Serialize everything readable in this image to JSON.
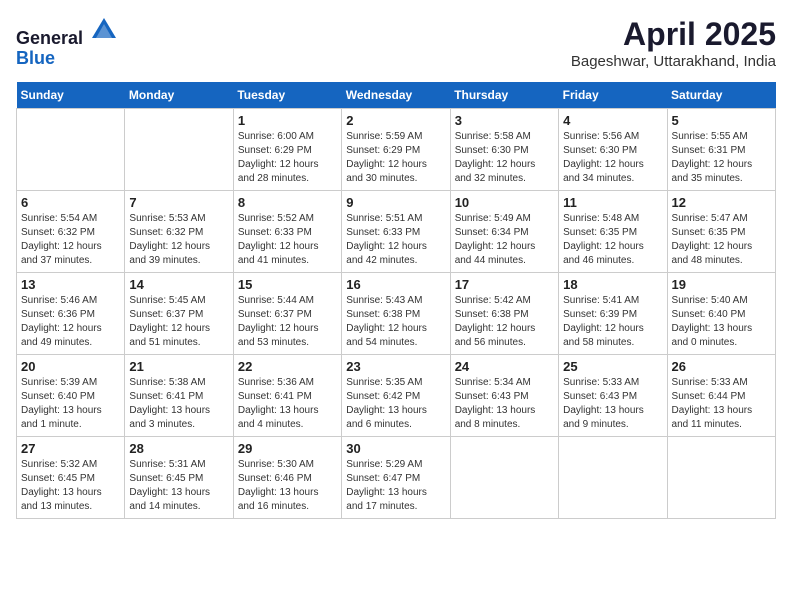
{
  "header": {
    "logo_line1": "General",
    "logo_line2": "Blue",
    "month": "April 2025",
    "location": "Bageshwar, Uttarakhand, India"
  },
  "days_of_week": [
    "Sunday",
    "Monday",
    "Tuesday",
    "Wednesday",
    "Thursday",
    "Friday",
    "Saturday"
  ],
  "weeks": [
    [
      {
        "day": "",
        "info": ""
      },
      {
        "day": "",
        "info": ""
      },
      {
        "day": "1",
        "info": "Sunrise: 6:00 AM\nSunset: 6:29 PM\nDaylight: 12 hours\nand 28 minutes."
      },
      {
        "day": "2",
        "info": "Sunrise: 5:59 AM\nSunset: 6:29 PM\nDaylight: 12 hours\nand 30 minutes."
      },
      {
        "day": "3",
        "info": "Sunrise: 5:58 AM\nSunset: 6:30 PM\nDaylight: 12 hours\nand 32 minutes."
      },
      {
        "day": "4",
        "info": "Sunrise: 5:56 AM\nSunset: 6:30 PM\nDaylight: 12 hours\nand 34 minutes."
      },
      {
        "day": "5",
        "info": "Sunrise: 5:55 AM\nSunset: 6:31 PM\nDaylight: 12 hours\nand 35 minutes."
      }
    ],
    [
      {
        "day": "6",
        "info": "Sunrise: 5:54 AM\nSunset: 6:32 PM\nDaylight: 12 hours\nand 37 minutes."
      },
      {
        "day": "7",
        "info": "Sunrise: 5:53 AM\nSunset: 6:32 PM\nDaylight: 12 hours\nand 39 minutes."
      },
      {
        "day": "8",
        "info": "Sunrise: 5:52 AM\nSunset: 6:33 PM\nDaylight: 12 hours\nand 41 minutes."
      },
      {
        "day": "9",
        "info": "Sunrise: 5:51 AM\nSunset: 6:33 PM\nDaylight: 12 hours\nand 42 minutes."
      },
      {
        "day": "10",
        "info": "Sunrise: 5:49 AM\nSunset: 6:34 PM\nDaylight: 12 hours\nand 44 minutes."
      },
      {
        "day": "11",
        "info": "Sunrise: 5:48 AM\nSunset: 6:35 PM\nDaylight: 12 hours\nand 46 minutes."
      },
      {
        "day": "12",
        "info": "Sunrise: 5:47 AM\nSunset: 6:35 PM\nDaylight: 12 hours\nand 48 minutes."
      }
    ],
    [
      {
        "day": "13",
        "info": "Sunrise: 5:46 AM\nSunset: 6:36 PM\nDaylight: 12 hours\nand 49 minutes."
      },
      {
        "day": "14",
        "info": "Sunrise: 5:45 AM\nSunset: 6:37 PM\nDaylight: 12 hours\nand 51 minutes."
      },
      {
        "day": "15",
        "info": "Sunrise: 5:44 AM\nSunset: 6:37 PM\nDaylight: 12 hours\nand 53 minutes."
      },
      {
        "day": "16",
        "info": "Sunrise: 5:43 AM\nSunset: 6:38 PM\nDaylight: 12 hours\nand 54 minutes."
      },
      {
        "day": "17",
        "info": "Sunrise: 5:42 AM\nSunset: 6:38 PM\nDaylight: 12 hours\nand 56 minutes."
      },
      {
        "day": "18",
        "info": "Sunrise: 5:41 AM\nSunset: 6:39 PM\nDaylight: 12 hours\nand 58 minutes."
      },
      {
        "day": "19",
        "info": "Sunrise: 5:40 AM\nSunset: 6:40 PM\nDaylight: 13 hours\nand 0 minutes."
      }
    ],
    [
      {
        "day": "20",
        "info": "Sunrise: 5:39 AM\nSunset: 6:40 PM\nDaylight: 13 hours\nand 1 minute."
      },
      {
        "day": "21",
        "info": "Sunrise: 5:38 AM\nSunset: 6:41 PM\nDaylight: 13 hours\nand 3 minutes."
      },
      {
        "day": "22",
        "info": "Sunrise: 5:36 AM\nSunset: 6:41 PM\nDaylight: 13 hours\nand 4 minutes."
      },
      {
        "day": "23",
        "info": "Sunrise: 5:35 AM\nSunset: 6:42 PM\nDaylight: 13 hours\nand 6 minutes."
      },
      {
        "day": "24",
        "info": "Sunrise: 5:34 AM\nSunset: 6:43 PM\nDaylight: 13 hours\nand 8 minutes."
      },
      {
        "day": "25",
        "info": "Sunrise: 5:33 AM\nSunset: 6:43 PM\nDaylight: 13 hours\nand 9 minutes."
      },
      {
        "day": "26",
        "info": "Sunrise: 5:33 AM\nSunset: 6:44 PM\nDaylight: 13 hours\nand 11 minutes."
      }
    ],
    [
      {
        "day": "27",
        "info": "Sunrise: 5:32 AM\nSunset: 6:45 PM\nDaylight: 13 hours\nand 13 minutes."
      },
      {
        "day": "28",
        "info": "Sunrise: 5:31 AM\nSunset: 6:45 PM\nDaylight: 13 hours\nand 14 minutes."
      },
      {
        "day": "29",
        "info": "Sunrise: 5:30 AM\nSunset: 6:46 PM\nDaylight: 13 hours\nand 16 minutes."
      },
      {
        "day": "30",
        "info": "Sunrise: 5:29 AM\nSunset: 6:47 PM\nDaylight: 13 hours\nand 17 minutes."
      },
      {
        "day": "",
        "info": ""
      },
      {
        "day": "",
        "info": ""
      },
      {
        "day": "",
        "info": ""
      }
    ]
  ]
}
